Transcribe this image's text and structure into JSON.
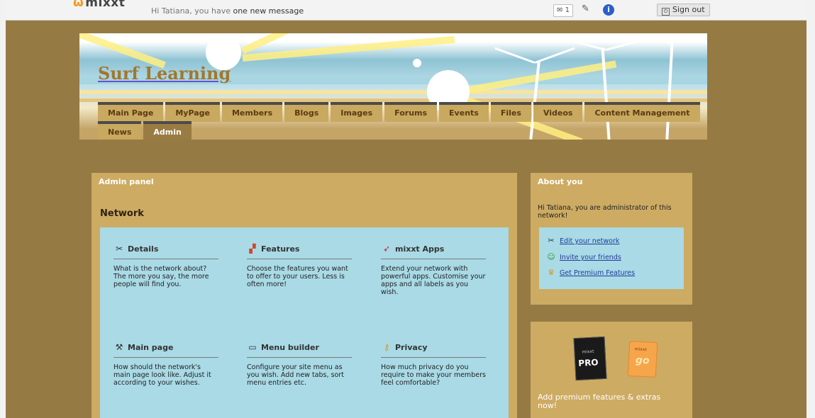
{
  "topbar": {
    "logo": "mixxt",
    "greeting_prefix": "Hi Tatiana, you have",
    "greeting_link": "one new message",
    "message_count": "1",
    "signout_label": "Sign out"
  },
  "header": {
    "title": "Surf Learning",
    "tabs_row1": [
      "Main Page",
      "MyPage",
      "Members",
      "Blogs",
      "Images",
      "Forums",
      "Events",
      "Files",
      "Videos",
      "Content Management"
    ],
    "tabs_row2": [
      "News",
      "Admin"
    ],
    "active_tab": "Admin"
  },
  "admin": {
    "title": "Admin panel",
    "section": "Network",
    "features": [
      {
        "title": "Details",
        "icon": "tools-icon",
        "desc": "What is the network about? The more you say, the more people will find you."
      },
      {
        "title": "Features",
        "icon": "blocks-icon",
        "desc": "Choose the features you want to offer to your users. Less is often more!"
      },
      {
        "title": "mixxt Apps",
        "icon": "rocket-icon",
        "desc": "Extend your network with powerful apps. Customise your apps and all labels as you wish."
      },
      {
        "title": "Main page",
        "icon": "wrench-icon",
        "desc": "How should the network's main page look like. Adjust it according to your wishes."
      },
      {
        "title": "Menu builder",
        "icon": "menu-icon",
        "desc": "Configure your site menu as you wish. Add new tabs, sort menu entries etc."
      },
      {
        "title": "Privacy",
        "icon": "key-icon",
        "desc": "How much privacy do you require to make your members feel comfortable?"
      }
    ]
  },
  "about": {
    "title": "About you",
    "text": "Hi Tatiana, you are administrator of this network!",
    "links": [
      {
        "label": "Edit your network",
        "icon": "tools-icon"
      },
      {
        "label": "Invite your friends",
        "icon": "invite-icon"
      },
      {
        "label": "Get Premium Features",
        "icon": "crown-icon"
      }
    ]
  },
  "premium": {
    "pro_label": "PRO",
    "pro_small": "mixxt",
    "go_label": "go",
    "go_small": "mixxt",
    "text": "Add premium features & extras now!"
  },
  "colors": {
    "page_bg": "#967a44",
    "panel": "#cdab63",
    "box": "#a9dae6",
    "link": "#243a9a"
  }
}
